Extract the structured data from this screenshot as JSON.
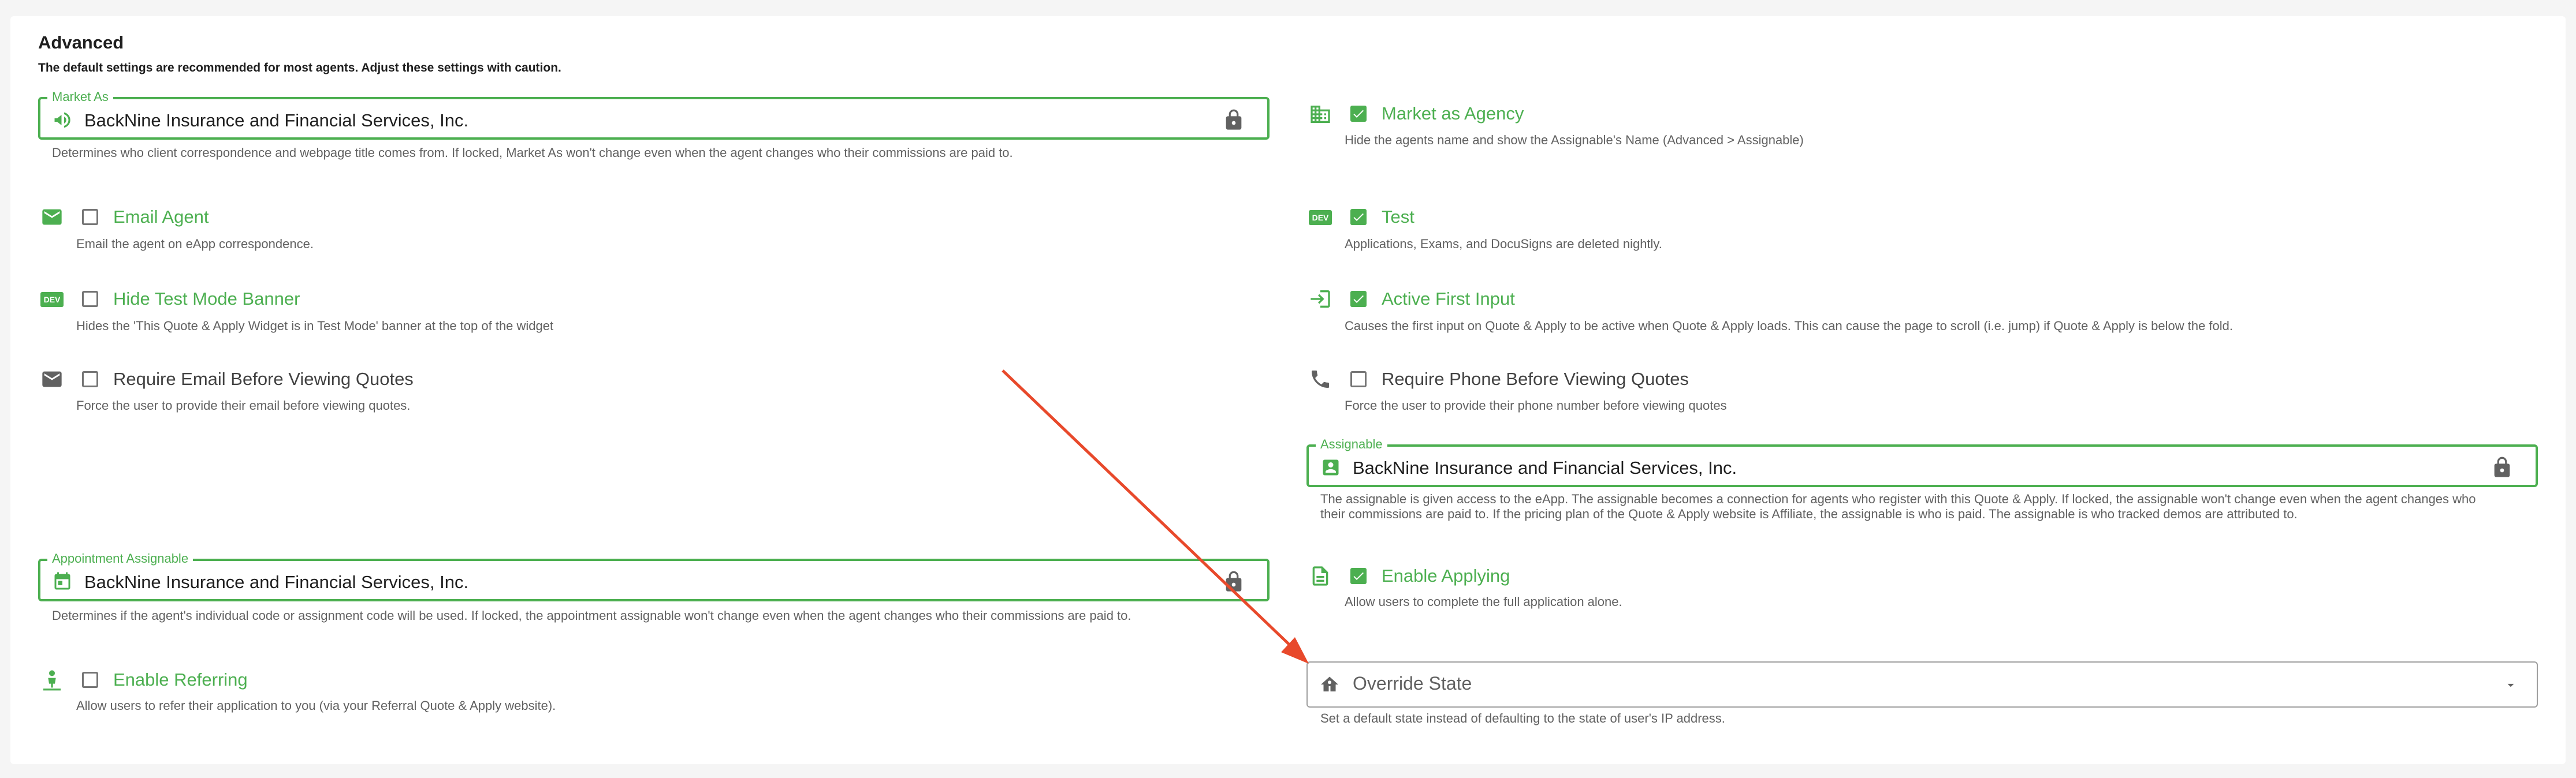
{
  "section": {
    "title": "Advanced",
    "subtitle": "The default settings are recommended for most agents. Adjust these settings with caution."
  },
  "left": {
    "market_as": {
      "label": "Market As",
      "value": "BackNine Insurance and Financial Services, Inc.",
      "hint": "Determines who client correspondence and webpage title comes from. If locked, Market As won't change even when the agent changes who their commissions are paid to."
    },
    "email_agent": {
      "label": "Email Agent",
      "checked": false,
      "description": "Email the agent on eApp correspondence."
    },
    "hide_test_mode_banner": {
      "label": "Hide Test Mode Banner",
      "checked": false,
      "badge": "DEV",
      "description": "Hides the 'This Quote & Apply Widget is in Test Mode' banner at the top of the widget"
    },
    "require_email": {
      "label": "Require Email Before Viewing Quotes",
      "checked": false,
      "description": "Force the user to provide their email before viewing quotes."
    },
    "appointment_assignable": {
      "label": "Appointment Assignable",
      "value": "BackNine Insurance and Financial Services, Inc.",
      "hint": "Determines if the agent's individual code or assignment code will be used. If locked, the appointment assignable won't change even when the agent changes who their commissions are paid to."
    },
    "enable_referring": {
      "label": "Enable Referring",
      "checked": false,
      "description": "Allow users to refer their application to you (via your Referral Quote & Apply website)."
    }
  },
  "right": {
    "market_as_agency": {
      "label": "Market as Agency",
      "checked": true,
      "description": "Hide the agents name and show the Assignable's Name (Advanced > Assignable)"
    },
    "test": {
      "label": "Test",
      "checked": true,
      "badge": "DEV",
      "description": "Applications, Exams, and DocuSigns are deleted nightly."
    },
    "active_first_input": {
      "label": "Active First Input",
      "checked": true,
      "description": "Causes the first input on Quote & Apply to be active when Quote & Apply loads. This can cause the page to scroll (i.e. jump) if Quote & Apply is below the fold."
    },
    "require_phone": {
      "label": "Require Phone Before Viewing Quotes",
      "checked": false,
      "description": "Force the user to provide their phone number before viewing quotes"
    },
    "assignable": {
      "label": "Assignable",
      "value": "BackNine Insurance and Financial Services, Inc.",
      "hint": "The assignable is given access to the eApp. The assignable becomes a connection for agents who register with this Quote & Apply. If locked, the assignable won't change even when the agent changes who their commissions are paid to. If the pricing plan of the Quote & Apply website is Affiliate, the assignable is who is paid. The assignable is who tracked demos are attributed to."
    },
    "enable_applying": {
      "label": "Enable Applying",
      "checked": true,
      "description": "Allow users to complete the full application alone."
    },
    "override_state": {
      "placeholder": "Override State",
      "hint": "Set a default state instead of defaulting to the state of user's IP address."
    }
  },
  "colors": {
    "accent": "#4caf50",
    "annotation": "#e8492b"
  }
}
